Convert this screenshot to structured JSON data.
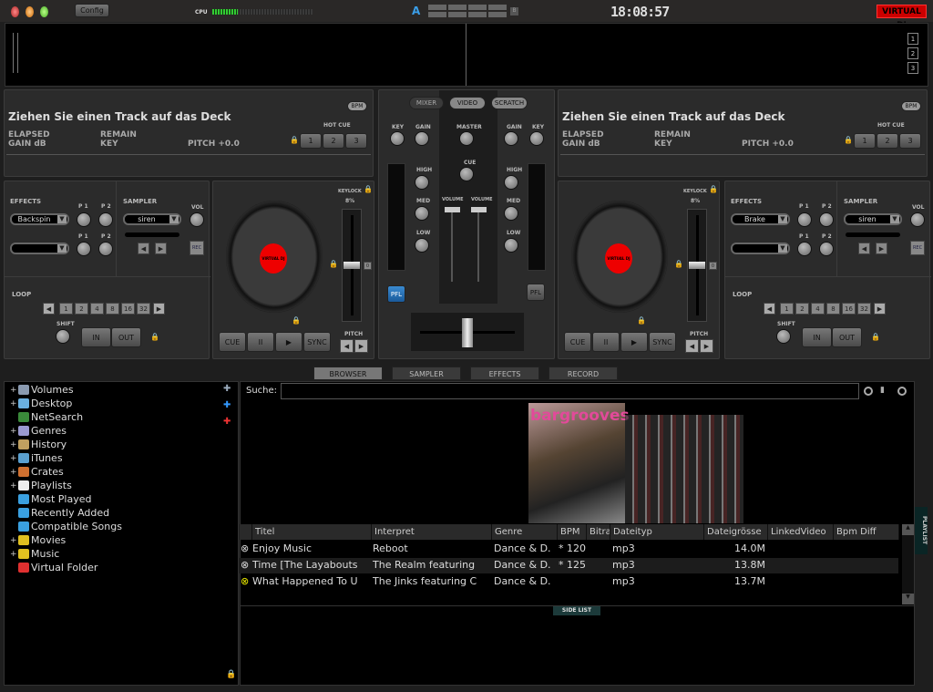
{
  "topbar": {
    "config_label": "Config",
    "cpu_label": "CPU",
    "cpu_load_percent": 25,
    "crossfader_a": "A",
    "crossfader_b": "B",
    "clock": "18:08:57",
    "logo": "VIRTUAL DJ"
  },
  "waveform": {
    "zoom_buttons": [
      "1",
      "2",
      "3"
    ]
  },
  "decks": [
    {
      "title": "Ziehen Sie einen Track auf das Deck",
      "elapsed": "ELAPSED",
      "remain": "REMAIN",
      "gain": "GAIN dB",
      "key": "KEY",
      "pitch": "PITCH +0.0",
      "bpm_label": "BPM",
      "hotcue_label": "HOT CUE",
      "hotcues": [
        "1",
        "2",
        "3"
      ],
      "effects_label": "EFFECTS",
      "effect": "Backspin",
      "p1": "P 1",
      "p2": "P 2",
      "sampler_label": "SAMPLER",
      "sample": "siren",
      "vol_label": "VOL",
      "rec_label": "REC",
      "loop_label": "LOOP",
      "loop_sizes": [
        "1",
        "2",
        "4",
        "8",
        "16",
        "32"
      ],
      "shift_label": "SHIFT",
      "in_label": "IN",
      "out_label": "OUT",
      "keylock_label": "KEYLOCK",
      "pitch_range": "8%",
      "pitch_label": "PITCH",
      "transport": [
        "CUE",
        "II",
        "▶",
        "SYNC"
      ],
      "platter_label": "VIRTUAL DJ"
    },
    {
      "title": "Ziehen Sie einen Track auf das Deck",
      "elapsed": "ELAPSED",
      "remain": "REMAIN",
      "gain": "GAIN dB",
      "key": "KEY",
      "pitch": "PITCH +0.0",
      "bpm_label": "BPM",
      "hotcue_label": "HOT CUE",
      "hotcues": [
        "1",
        "2",
        "3"
      ],
      "effects_label": "EFFECTS",
      "effect": "Brake",
      "p1": "P 1",
      "p2": "P 2",
      "sampler_label": "SAMPLER",
      "sample": "siren",
      "vol_label": "VOL",
      "rec_label": "REC",
      "loop_label": "LOOP",
      "loop_sizes": [
        "1",
        "2",
        "4",
        "8",
        "16",
        "32"
      ],
      "shift_label": "SHIFT",
      "in_label": "IN",
      "out_label": "OUT",
      "keylock_label": "KEYLOCK",
      "pitch_range": "8%",
      "pitch_label": "PITCH",
      "transport": [
        "CUE",
        "II",
        "▶",
        "SYNC"
      ],
      "platter_label": "VIRTUAL DJ"
    }
  ],
  "mixer": {
    "tabs": [
      "MIXER",
      "VIDEO",
      "SCRATCH"
    ],
    "key": "KEY",
    "gain": "GAIN",
    "master": "MASTER",
    "cue": "CUE",
    "high": "HIGH",
    "med": "MED",
    "low": "LOW",
    "volume": "VOLUME",
    "pfl": "PFL"
  },
  "browser_tabs": [
    "BROWSER",
    "SAMPLER",
    "EFFECTS",
    "RECORD"
  ],
  "tree": [
    {
      "label": "Volumes",
      "expand": "+",
      "color": "#8a9ab0"
    },
    {
      "label": "Desktop",
      "expand": "+",
      "color": "#6ab0e0"
    },
    {
      "label": "NetSearch",
      "expand": "",
      "color": "#3a8a3a"
    },
    {
      "label": "Genres",
      "expand": "+",
      "color": "#9a9ad0"
    },
    {
      "label": "History",
      "expand": "+",
      "color": "#c0a060"
    },
    {
      "label": "iTunes",
      "expand": "+",
      "color": "#5aa0d0"
    },
    {
      "label": "Crates",
      "expand": "+",
      "color": "#d07030"
    },
    {
      "label": "Playlists",
      "expand": "+",
      "color": "#eeeeee"
    },
    {
      "label": "Most Played",
      "expand": "",
      "color": "#3aa0e0"
    },
    {
      "label": "Recently Added",
      "expand": "",
      "color": "#3aa0e0"
    },
    {
      "label": "Compatible Songs",
      "expand": "",
      "color": "#3aa0e0"
    },
    {
      "label": "Movies",
      "expand": "+",
      "color": "#e0c020"
    },
    {
      "label": "Music",
      "expand": "+",
      "color": "#e0c020"
    },
    {
      "label": "Virtual Folder",
      "expand": "",
      "color": "#e03030"
    }
  ],
  "search": {
    "label": "Suche:",
    "value": ""
  },
  "cover": {
    "text": "bargrooves"
  },
  "table": {
    "columns": [
      "Titel",
      "Interpret",
      "Genre",
      "BPM",
      "Bitra",
      "Dateityp",
      "Dateigrösse",
      "LinkedVideo",
      "Bpm Diff"
    ],
    "rows": [
      {
        "title": "Enjoy Music",
        "artist": "Reboot",
        "genre": "Dance & D.",
        "bpm": "* 120",
        "type": "mp3",
        "size": "14.0M"
      },
      {
        "title": "Time [The Layabouts",
        "artist": "The Realm featuring",
        "genre": "Dance & D.",
        "bpm": "* 125",
        "type": "mp3",
        "size": "13.8M"
      },
      {
        "title": "What Happened To U",
        "artist": "The Jinks featuring C",
        "genre": "Dance & D.",
        "bpm": "",
        "type": "mp3",
        "size": "13.7M"
      }
    ]
  },
  "side_list_label": "SIDE LIST",
  "playlist_tab": "PLAYLIST"
}
